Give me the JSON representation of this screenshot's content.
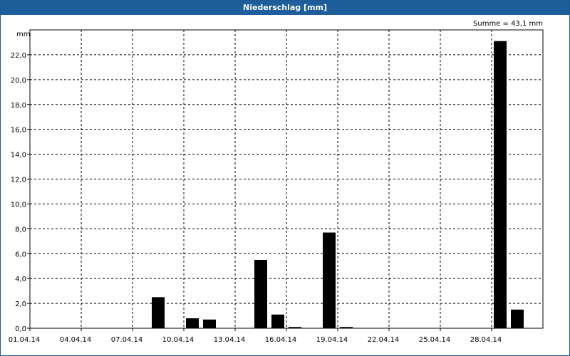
{
  "window": {
    "title": "Niederschlag [mm]"
  },
  "chart_data": {
    "type": "bar",
    "title": "Niederschlag [mm]",
    "ylabel": "mm",
    "summary": "Summe = 43,1 mm",
    "x_tick_labels": [
      "01.04.14",
      "04.04.14",
      "07.04.14",
      "10.04.14",
      "13.04.14",
      "16.04.14",
      "19.04.14",
      "22.04.14",
      "25.04.14",
      "28.04.14"
    ],
    "y_tick_labels": [
      "0,0",
      "2,0",
      "4,0",
      "6,0",
      "8,0",
      "10,0",
      "12,0",
      "14,0",
      "16,0",
      "18,0",
      "20,0",
      "22,0"
    ],
    "x": [
      "01.04.14",
      "02.04.14",
      "03.04.14",
      "04.04.14",
      "05.04.14",
      "06.04.14",
      "07.04.14",
      "08.04.14",
      "09.04.14",
      "10.04.14",
      "11.04.14",
      "12.04.14",
      "13.04.14",
      "14.04.14",
      "15.04.14",
      "16.04.14",
      "17.04.14",
      "18.04.14",
      "19.04.14",
      "20.04.14",
      "21.04.14",
      "22.04.14",
      "23.04.14",
      "24.04.14",
      "25.04.14",
      "26.04.14",
      "27.04.14",
      "28.04.14",
      "29.04.14",
      "30.04.14"
    ],
    "values": [
      0,
      0,
      0,
      0,
      0,
      0,
      0,
      2.5,
      0,
      0.8,
      0.7,
      0,
      0,
      5.5,
      1.1,
      0.1,
      0,
      7.7,
      0.1,
      0,
      0,
      0,
      0,
      0,
      0,
      0,
      0,
      23.1,
      1.5,
      0
    ],
    "ylim": [
      0,
      24
    ],
    "grid": true,
    "bar_color": "#000000"
  }
}
